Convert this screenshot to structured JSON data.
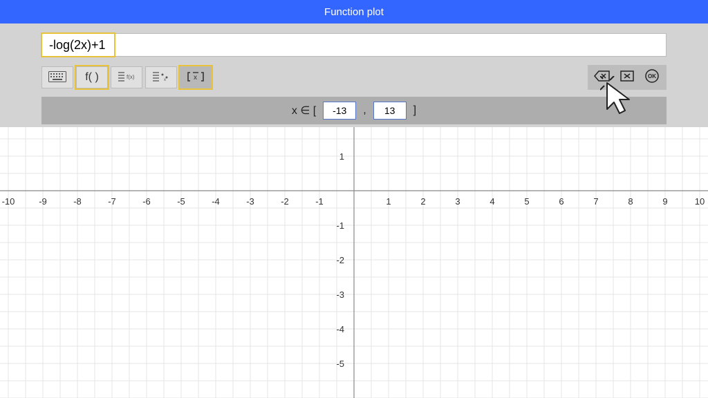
{
  "title": "Function plot",
  "expression": "-log(2x)+1",
  "toolbar": {
    "keyboard": "⌨",
    "fx": "f( )",
    "list_fx": "f(x)",
    "list_xy": "x,y",
    "bracket": "[ x ]"
  },
  "actions": {
    "backspace": "⌫",
    "clear": "✕",
    "ok": "OK"
  },
  "domain": {
    "prefix": "x ∈ [",
    "min": "-13",
    "sep": ",",
    "max": "13",
    "suffix": "]"
  },
  "chart_data": {
    "type": "line",
    "title": "",
    "xlabel": "",
    "ylabel": "",
    "xlim": [
      -10,
      10
    ],
    "ylim": [
      -5,
      1
    ],
    "x_ticks": [
      -10,
      -9,
      -8,
      -7,
      -6,
      -5,
      -4,
      -3,
      -2,
      -1,
      1,
      2,
      3,
      4,
      5,
      6,
      7,
      8,
      9,
      10
    ],
    "y_ticks": [
      1,
      -1,
      -2,
      -3,
      -4,
      -5
    ],
    "series": []
  }
}
